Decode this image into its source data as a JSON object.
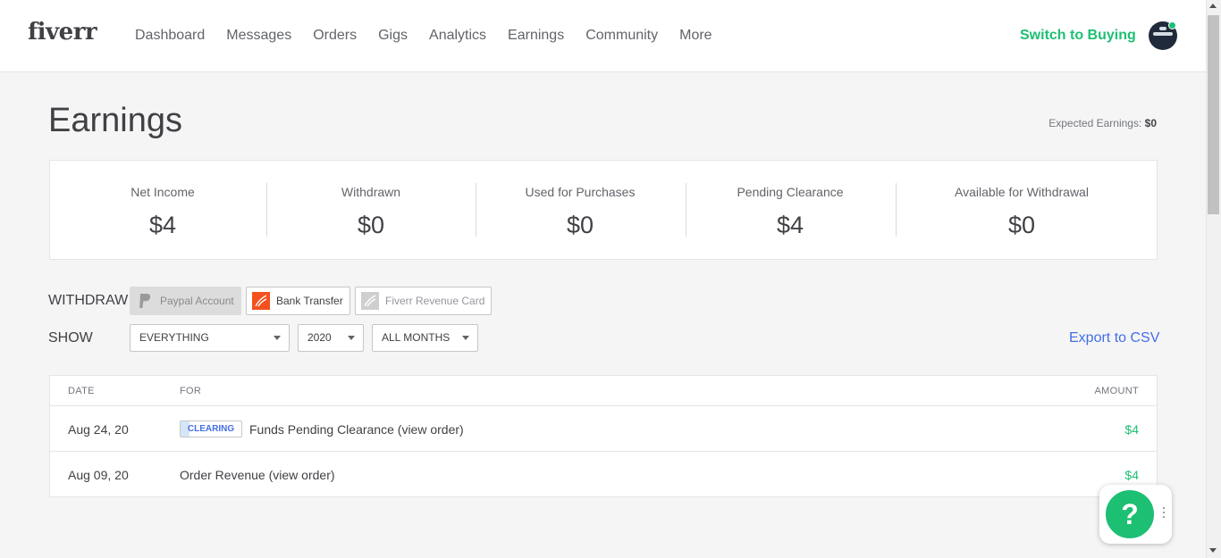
{
  "header": {
    "logo": "fiverr",
    "nav": [
      "Dashboard",
      "Messages",
      "Orders",
      "Gigs",
      "Analytics",
      "Earnings",
      "Community",
      "More"
    ],
    "switch_label": "Switch to Buying"
  },
  "page": {
    "title": "Earnings",
    "expected_label": "Expected Earnings:",
    "expected_value": "$0"
  },
  "stats": [
    {
      "label": "Net Income",
      "value": "$4"
    },
    {
      "label": "Withdrawn",
      "value": "$0"
    },
    {
      "label": "Used for Purchases",
      "value": "$0"
    },
    {
      "label": "Pending Clearance",
      "value": "$4"
    },
    {
      "label": "Available for Withdrawal",
      "value": "$0"
    }
  ],
  "withdraw": {
    "label": "WITHDRAW",
    "paypal": "Paypal Account",
    "bank": "Bank Transfer",
    "card": "Fiverr Revenue Card"
  },
  "show": {
    "label": "SHOW",
    "type_filter": "EVERYTHING",
    "year_filter": "2020",
    "month_filter": "ALL MONTHS",
    "export": "Export to CSV"
  },
  "table": {
    "headers": {
      "date": "DATE",
      "for": "FOR",
      "amount": "AMOUNT"
    },
    "rows": [
      {
        "date": "Aug 24, 20",
        "badge": "CLEARING",
        "description": "Funds Pending Clearance",
        "link": "(view order)",
        "amount": "$4"
      },
      {
        "date": "Aug 09, 20",
        "badge": "",
        "description": "Order Revenue",
        "link": "(view order)",
        "amount": "$4"
      }
    ]
  },
  "help": {
    "symbol": "?"
  },
  "colors": {
    "brand_green": "#1dbf73",
    "link_blue": "#446ee7",
    "text_dark": "#404145"
  }
}
